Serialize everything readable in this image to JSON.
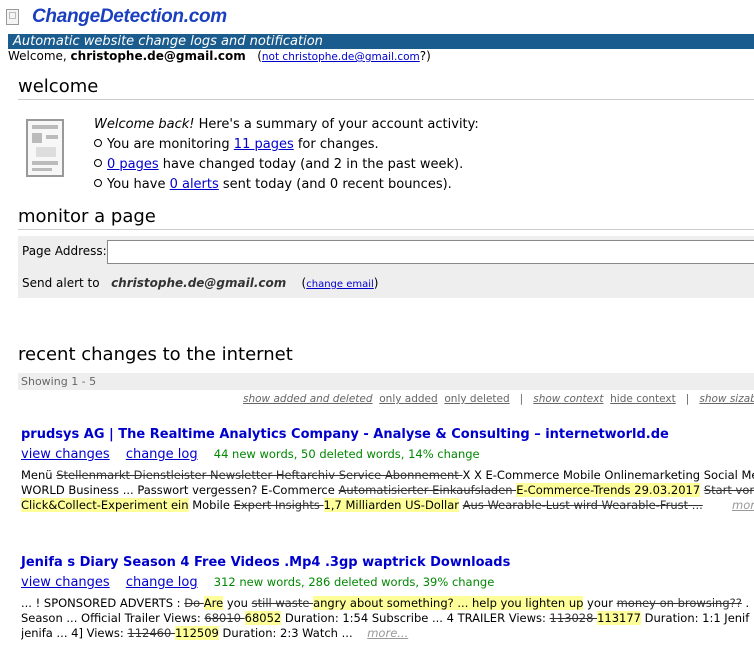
{
  "header": {
    "logo": "ChangeDetection.com",
    "tagline": "Automatic website change logs and notification"
  },
  "welcome": {
    "prefix": "Welcome, ",
    "email": "christophe.de@gmail.com",
    "not_link": "not christophe.de@gmail.com",
    "open_paren": "(",
    "close_paren": "?)"
  },
  "summary": {
    "heading": "welcome",
    "intro_em": "Welcome back!",
    "intro_rest": " Here's a summary of your account activity:",
    "line1_pre": "You are monitoring ",
    "line1_link": "11 pages",
    "line1_post": " for changes.",
    "line2_link": "0 pages",
    "line2_post": " have changed today (and 2 in the past week).",
    "line3_pre": "You have ",
    "line3_link": "0 alerts",
    "line3_post": " sent today (and 0 recent bounces)."
  },
  "monitor": {
    "heading": "monitor a page",
    "address_label": "Page Address:",
    "address_value": "",
    "alert_label": "Send alert to",
    "alert_email": "christophe.de@gmail.com",
    "change_email": "change email"
  },
  "recent": {
    "heading": "recent changes to the internet",
    "showing": "Showing 1 - 5",
    "filter_added_deleted": "show added and deleted",
    "filter_only_added": "only added",
    "filter_only_deleted": "only deleted",
    "sep": "|",
    "filter_show_context": "show context",
    "filter_hide_context": "hide context",
    "filter_show_size": "show sizab"
  },
  "entries": [
    {
      "title": "prudsys AG | The Realtime Analytics Company - Analyse & Consulting – internetworld.de",
      "view_changes": "view changes",
      "change_log": "change log",
      "stats": "44 new words, 50 deleted words, 14% change",
      "l1_a": "Menü ",
      "l1_del": "Stellenmarkt Dienstleister Newsletter Heftarchiv Service Abonnement ",
      "l1_b": "X X E-Commerce Mobile Onlinemarketing Social Me",
      "l2_a": "WORLD Business ... Passwort vergessen? E-Commerce ",
      "l2_del": "Automatisierter Einkaufsladen ",
      "l2_hl": "E-Commerce-Trends 29.03.2017",
      "l2_b": " ",
      "l2_del2": "Start vor",
      "l3_hl": "Click&Collect-Experiment ein",
      "l3_a": " Mobile ",
      "l3_del": "Expert Insights ",
      "l3_hl2": "1,7 Milliarden US-Dollar",
      "l3_b": " ",
      "l3_del2": "Aus Wearable-Lust wird Wearable-Frust ...",
      "more": "more..."
    },
    {
      "title": "Jenifa s Diary Season 4 Free Videos .Mp4 .3gp waptrick Downloads",
      "view_changes": "view changes",
      "change_log": "change log",
      "stats": "312 new words, 286 deleted words, 39% change",
      "l1_a": "... ! SPONSORED ADVERTS : ",
      "l1_del": "Do ",
      "l1_hl": "Are",
      "l1_b": " you ",
      "l1_del2": "still waste ",
      "l1_hl2": "angry about something? ... help you lighten up",
      "l1_c": " your ",
      "l1_del3": "money on browsing??",
      "l1_d": " .",
      "l2_a": "Season ... Official Trailer Views: ",
      "l2_del": "68010 ",
      "l2_hl": "68052",
      "l2_b": " Duration: 1:54 Subscribe ... 4 TRAILER Views: ",
      "l2_del2": "113028 ",
      "l2_hl2": "113177",
      "l2_c": " Duration: 1:1 Jenif",
      "l3_a": "jenifa ... 4] Views: ",
      "l3_del": "112460 ",
      "l3_hl": "112509",
      "l3_b": " Duration: 2:3 Watch ... ",
      "more": "more..."
    }
  ]
}
